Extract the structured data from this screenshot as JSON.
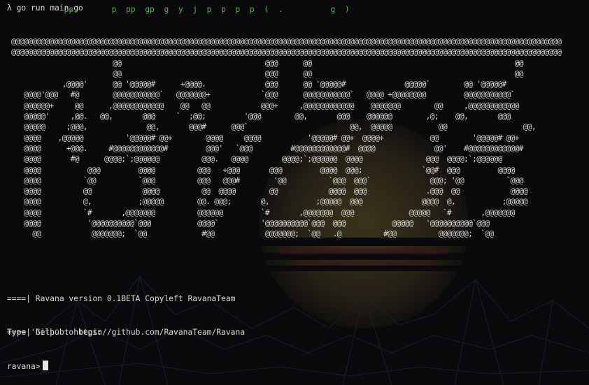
{
  "terminal": {
    "top_fragment": "        pp        p  pp  gp  g  y  j  p  p  p  p  (  .          g  )",
    "command": "λ go run main.go",
    "banner": [
      "@@@@@@@@@@@@@@@@@@@@@@@@@@@@@@@@@@@@@@@@@@@@@@@@@@@@@@@@@@@@@@@@@@@@@@@@@@@@@@@@@@@@@@@@@@@@@@@@@@@@@@@@@@@@@@@@@@@@@@@@@@@@@@@@@@",
      "@@@@@@@@@@@@@@@@@@@@@@@@@@@@@@@@@@@@@@@@@@@@@@@@@@@@@@@@@@@@@@@@@@@@@@@@@@@@@@@@@@@@@@@@@@@@@@@@@@@@@@@@@@@@@@@@@@@@@@@@@@@@@@@@@@",
      "                        @@                                  @@@      @@                                                @@",
      "                        @@                                  @@@      @@                                                @@",
      "            ,@@@@'      @@ '@@@@@#      +@@@@.              @@@      @@ '@@@@@#              @@@@@`        @@ '@@@@@#",
      "   @@@@'@@@   #@        @@@@@@@@@@@`   @@@@@@@+            `@@@      @@@@@@@@@@@`   @@@@ +@@@@@@@@         @@@@@@@@@@@`",
      "   @@@@@@+     @@      ,@@@@@@@@@@@@    @@   @@            @@@+     ,@@@@@@@@@@@@    @@@@@@@        @@     ,@@@@@@@@@@@@",
      "   @@@@@'     ,@@.   @@,       @@@     `  ;@@;         '@@@        @@,       @@@    @@@@@@        ,@;    @@,       @@@",
      "   @@@@@     ;@@@,              @@,       @@@#      @@@`                        @@,  @@@@@           @@                  @@,",
      "   @@@@    ,@@@@@          '@@@@@# @@+        @@@@     @@@@           '@@@@@# @@+  @@@@+           @@        '@@@@@# @@+",
      "   @@@@      +@@@.     #@@@@@@@@@@@@#         @@@'   `@@@         #@@@@@@@@@@@@#  @@@@              @@'    #@@@@@@@@@@@@#",
      "   @@@@       #@      @@@@;`;@@@@@@          @@@.   @@@@        @@@@;`;@@@@@@  @@@@               @@@  @@@@;`;@@@@@@",
      "   @@@@           @@@         @@@@          @@@   +@@@       @@@         @@@@  @@@;              `@@#  @@@         @@@@",
      "   @@@@          `@@          `@@@          @@@   @@@#        '@@          `@@@  @@@`              @@@; '@@          `@@@",
      "   @@@@          @@            @@@@          @@  @@@@        @@            @@@@  @@@              .@@@  @@            @@@@",
      "   @@@@          @,           ;@@@@@        @@. @@@;       @,           ;@@@@@  @@@              @@@@  @,           ;@@@@@",
      "   @@@@          `#       ,@@@@@@@          @@@@@@         `#       ,@@@@@@@  @@@             @@@@@   `#       ,@@@@@@@",
      "   @@@@           '@@@@@@@@@@`@@@           @@@@`          '@@@@@@@@@@`@@@  @@@           @@@@@   '@@@@@@@@@@`@@@",
      "     @@            @@@@@@@;  `@@             #@@            @@@@@@@;  `@@   .@          #@@          @@@@@@@;  `@@"
    ],
    "info": [
      "====| Ravana version 0.1BETA Copyleft RavanaTeam",
      "====| Github: https://github.com/RavanaTeam/Ravana"
    ],
    "help": "Type 'help' to begin",
    "prompt": "ravana>"
  },
  "colors": {
    "background": "#0a0a0c",
    "text": "#d8d8d8",
    "green": "#4fb34a"
  }
}
